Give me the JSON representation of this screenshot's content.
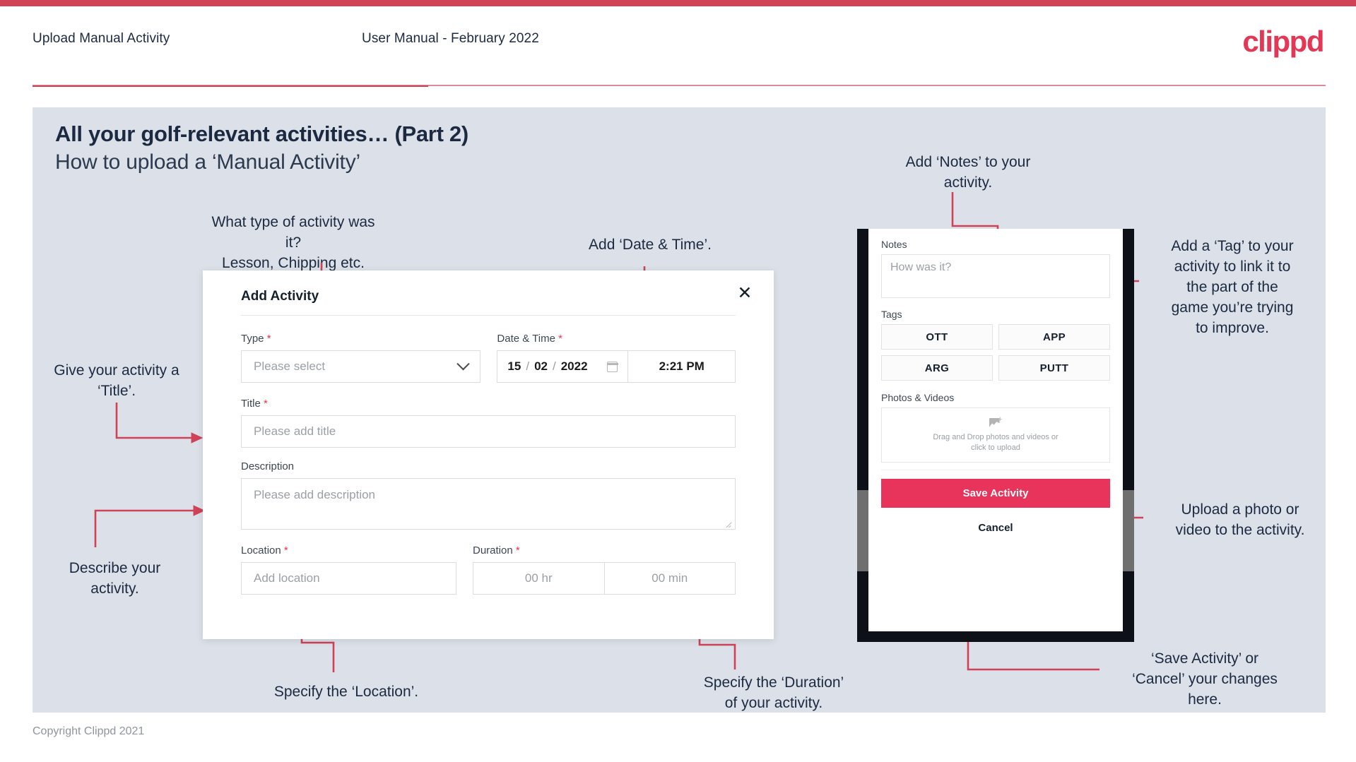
{
  "header": {
    "title": "Upload Manual Activity",
    "subtitle": "User Manual - February 2022",
    "brand": "clippd",
    "brand_color": "#e43755",
    "accent_color": "#cf4257"
  },
  "slide": {
    "title": "All your golf-relevant activities… (Part 2)",
    "subtitle": "How to upload a ‘Manual Activity’",
    "background": "#dce1e9"
  },
  "annotations": [
    {
      "id": "type",
      "text": "What type of activity was it?\nLesson, Chipping etc."
    },
    {
      "id": "datetime",
      "text": "Add ‘Date & Time’."
    },
    {
      "id": "notes",
      "text": "Add ‘Notes’ to your\nactivity."
    },
    {
      "id": "tag",
      "text": "Add a ‘Tag’ to your\nactivity to link it to\nthe part of the\ngame you’re trying\nto improve."
    },
    {
      "id": "title",
      "text": "Give your activity a\n‘Title’."
    },
    {
      "id": "describe",
      "text": "Describe your\nactivity."
    },
    {
      "id": "location",
      "text": "Specify the ‘Location’."
    },
    {
      "id": "duration",
      "text": "Specify the ‘Duration’\nof your activity."
    },
    {
      "id": "upload",
      "text": "Upload a photo or\nvideo to the activity."
    },
    {
      "id": "savecancel",
      "text": "‘Save Activity’ or\n‘Cancel’ your changes\nhere."
    }
  ],
  "dialog": {
    "title": "Add Activity",
    "close_icon": "close-icon",
    "fields": {
      "type": {
        "label": "Type",
        "required_marker": "*",
        "placeholder": "Please select",
        "icon": "chevron-down-icon"
      },
      "datetime": {
        "label": "Date & Time",
        "required_marker": "*",
        "day": "15",
        "month": "02",
        "year": "2022",
        "separator": "/",
        "calendar_icon": "calendar-icon",
        "time": "2:21 PM"
      },
      "title": {
        "label": "Title",
        "required_marker": "*",
        "placeholder": "Please add title"
      },
      "description": {
        "label": "Description",
        "required_marker": "",
        "placeholder": "Please add description"
      },
      "location": {
        "label": "Location",
        "required_marker": "*",
        "placeholder": "Add location"
      },
      "duration": {
        "label": "Duration",
        "required_marker": "*",
        "hours_placeholder": "00 hr",
        "minutes_placeholder": "00 min"
      }
    }
  },
  "phone": {
    "notes": {
      "label": "Notes",
      "placeholder": "How was it?"
    },
    "tags": {
      "label": "Tags",
      "items": [
        "OTT",
        "APP",
        "ARG",
        "PUTT"
      ]
    },
    "photos": {
      "label": "Photos & Videos",
      "icon": "add-image-icon",
      "dropzone_line1": "Drag and Drop photos and videos or",
      "dropzone_line2": "click to upload"
    },
    "save_label": "Save Activity",
    "save_color": "#e8335b",
    "cancel_label": "Cancel"
  },
  "footer": {
    "copyright": "Copyright Clippd 2021"
  }
}
